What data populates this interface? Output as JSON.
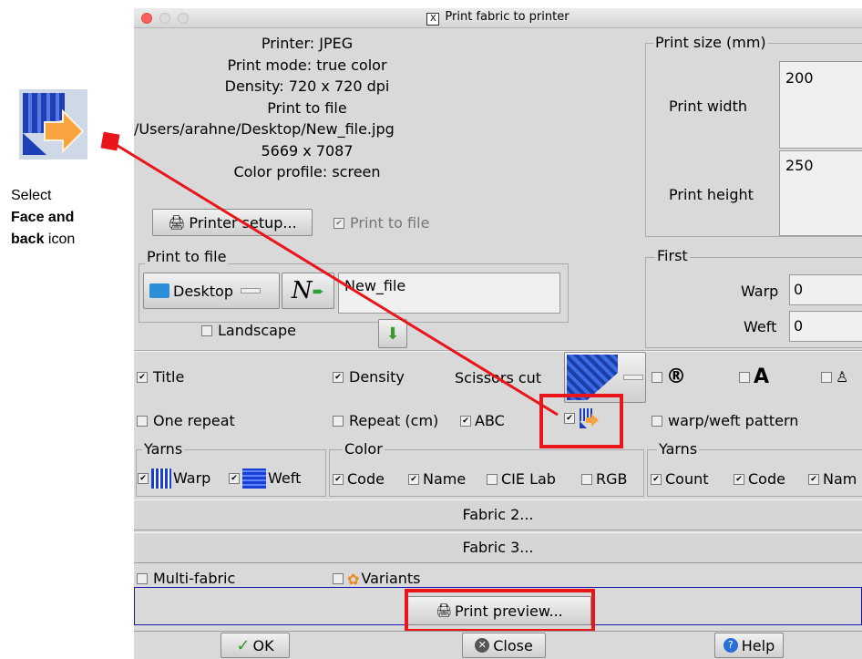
{
  "annotation": {
    "caption_line1": "Select",
    "caption_bold": "Face and back",
    "caption_bold2": "back",
    "caption_line3": "icon",
    "arrow_color": "#e8151b"
  },
  "window": {
    "title": "Print fabric to printer",
    "x_badge": "X"
  },
  "printer_info": {
    "printer": "Printer: JPEG",
    "mode": "Print mode: true color",
    "density": "Density: 720 x 720 dpi",
    "print_to": "Print to file",
    "path": "/Users/arahne/Desktop/New_file.jpg",
    "size": "5669 x 7087",
    "profile": "Color profile: screen"
  },
  "printer_setup_label": "Printer setup...",
  "print_to_file_check": "Print to file",
  "print_size": {
    "legend": "Print size (mm)",
    "width_label": "Print width",
    "width_value": "200",
    "height_label": "Print height",
    "height_value": "250"
  },
  "print_to_file_group": {
    "legend": "Print to file",
    "folder": "Desktop",
    "filename": "New_file"
  },
  "landscape_label": "Landscape",
  "first": {
    "legend": "First",
    "warp_label": "Warp",
    "warp_value": "0",
    "weft_label": "Weft",
    "weft_value": "0"
  },
  "options": {
    "title": "Title",
    "density": "Density",
    "scissors": "Scissors cut",
    "one_repeat": "One repeat",
    "repeat_cm": "Repeat (cm)",
    "abc": "ABC",
    "warp_weft_pattern": "warp/weft pattern",
    "registered": "®",
    "bold_a": "A"
  },
  "yarns_left": {
    "legend": "Yarns",
    "warp": "Warp",
    "weft": "Weft"
  },
  "color": {
    "legend": "Color",
    "code": "Code",
    "name": "Name",
    "cielab": "CIE Lab",
    "rgb": "RGB"
  },
  "yarns_right": {
    "legend": "Yarns",
    "count": "Count",
    "code": "Code",
    "name": "Nam"
  },
  "fabric2_label": "Fabric 2...",
  "fabric3_label": "Fabric 3...",
  "multi_fabric_label": "Multi-fabric",
  "variants_label": "Variants",
  "print_preview_label": "Print preview...",
  "bottom": {
    "ok": "OK",
    "close": "Close",
    "help": "Help"
  }
}
